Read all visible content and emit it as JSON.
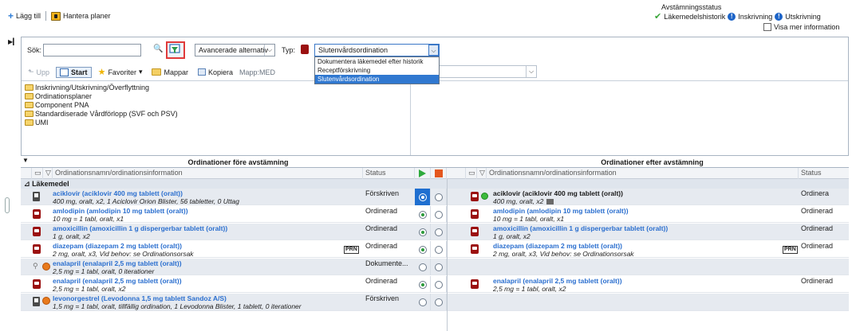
{
  "toolbar": {
    "add_label": "Lägg till",
    "manage_plans_label": "Hantera planer"
  },
  "reconciliation_status": {
    "title": "Avstämningsstatus",
    "items": [
      "Läkemedelshistorik",
      "Inskrivning",
      "Utskrivning"
    ],
    "show_more_label": "Visa mer information"
  },
  "search": {
    "label": "Sök:",
    "value": "",
    "advanced_label": "Avancerade alternativ",
    "type_label": "Typ:",
    "type_value": "Slutenvårdsordination",
    "type_options": [
      "Dokumentera läkemedel efter historik",
      "Receptförskrivning",
      "Slutenvårdsordination"
    ]
  },
  "nav": {
    "up_label": "Upp",
    "start_label": "Start",
    "favorites_label": "Favoriter",
    "folders_label": "Mappar",
    "copy_label": "Kopiera",
    "folder_path": "Mapp:MED"
  },
  "folders": [
    "Inskrivning/Utskrivning/Överflyttning",
    "Ordinationsplaner",
    "Component PNA",
    "Standardiserade Vårdförlopp (SVF och PSV)",
    "UMI"
  ],
  "grid": {
    "before_title": "Ordinationer före avstämning",
    "after_title": "Ordinationer efter avstämning",
    "col_name": "Ordinationsnamn/ordinationsinformation",
    "col_status": "Status",
    "group": "Läkemedel",
    "rows": [
      {
        "name": "aciklovir (aciklovir 400 mg tablett (oralt))",
        "info": "400 mg, oralt, x2, 1 Aciclovir Orion Blister, 56 tabletter, 0 Uttag",
        "status": "Förskriven",
        "after_name": "aciklovir (aciklovir 400 mg tablett (oralt))",
        "after_info": "400 mg, oralt, x2",
        "after_status": "Ordinera"
      },
      {
        "name": "amlodipin (amlodipin 10 mg tablett (oralt))",
        "info": "10 mg = 1 tabl, oralt, x1",
        "status": "Ordinerad",
        "after_name": "amlodipin (amlodipin 10 mg tablett (oralt))",
        "after_info": "10 mg = 1 tabl, oralt, x1",
        "after_status": "Ordinerad"
      },
      {
        "name": "amoxicillin (amoxicillin 1 g dispergerbar tablett (oralt))",
        "info": "1 g, oralt, x2",
        "status": "Ordinerad",
        "after_name": "amoxicillin (amoxicillin 1 g dispergerbar tablett (oralt))",
        "after_info": "1 g, oralt, x2",
        "after_status": "Ordinerad"
      },
      {
        "name": "diazepam (diazepam 2 mg tablett (oralt))",
        "info": "2 mg, oralt, x3, Vid behov: se Ordinationsorsak",
        "status": "Ordinerad",
        "prn": "PRN",
        "after_name": "diazepam (diazepam 2 mg tablett (oralt))",
        "after_info": "2 mg, oralt, x3, Vid behov: se Ordinationsorsak",
        "after_status": "Ordinerad",
        "after_prn": "PRN"
      },
      {
        "name": "enalapril (enalapril 2,5 mg tablett (oralt))",
        "info": "2,5 mg = 1 tabl, oralt, 0 iterationer",
        "status": "Dokumente..."
      },
      {
        "name": "enalapril (enalapril 2,5 mg tablett (oralt))",
        "info": "2,5 mg = 1 tabl, oralt, x2",
        "status": "Ordinerad",
        "after_name": "enalapril (enalapril 2,5 mg tablett (oralt))",
        "after_info": "2,5 mg = 1 tabl, oralt, x2",
        "after_status": "Ordinerad"
      },
      {
        "name": "levonorgestrel (Levodonna 1,5 mg tablett Sandoz A/S)",
        "info": "1,5 mg = 1 tabl, oralt, tillfällig ordination, 1 Levodonna Blister, 1 tablett, 0 iterationer",
        "status": "Förskriven"
      }
    ]
  }
}
